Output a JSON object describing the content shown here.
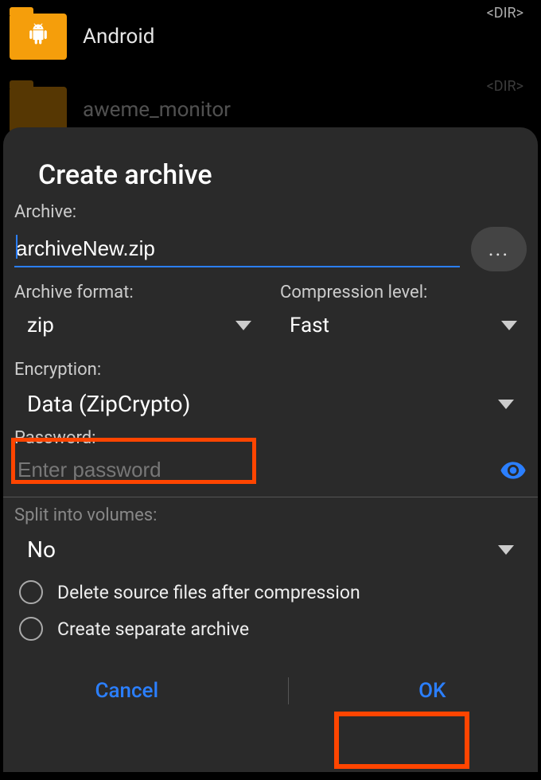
{
  "background": {
    "items": [
      {
        "label": "Android",
        "dir_tag": "<DIR>",
        "has_android_glyph": true
      },
      {
        "label": "aweme_monitor",
        "dir_tag": "<DIR>",
        "has_android_glyph": false
      }
    ]
  },
  "dialog": {
    "title": "Create archive",
    "archive_label": "Archive:",
    "archive_value": "archiveNew.zip",
    "browse_label": "...",
    "format_label": "Archive format:",
    "format_value": "zip",
    "compression_label": "Compression level:",
    "compression_value": "Fast",
    "encryption_label": "Encryption:",
    "encryption_value": "Data (ZipCrypto)",
    "password_label": "Password:",
    "password_placeholder": "Enter password",
    "split_label": "Split into volumes:",
    "split_value": "No",
    "delete_source_label": "Delete source files after compression",
    "separate_archive_label": "Create separate archive",
    "cancel_label": "Cancel",
    "ok_label": "OK"
  }
}
